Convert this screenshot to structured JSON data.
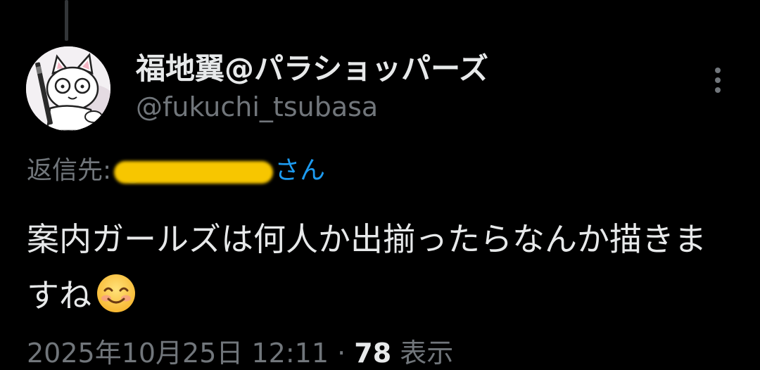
{
  "colors": {
    "background": "#000000",
    "primary_text": "#e7e9ea",
    "secondary_text": "#71767b",
    "link": "#1d9bf0",
    "redaction": "#f7c600"
  },
  "author": {
    "display_name": "福地翼@パラショッパーズ",
    "handle": "@fukuchi_tsubasa",
    "avatar_icon": "cat-avatar-icon"
  },
  "more_icon": "more-vertical-icon",
  "reply": {
    "prefix": "返信先:",
    "redacted_user": "@",
    "suffix": "さん"
  },
  "tweet": {
    "text": "案内ガールズは何人か出揃ったらなんか描きますね",
    "emoji": "smiling-face-icon"
  },
  "meta": {
    "timestamp": "2025年10月25日 12:11",
    "separator": " · ",
    "views_count": "78",
    "views_label": " 表示"
  }
}
